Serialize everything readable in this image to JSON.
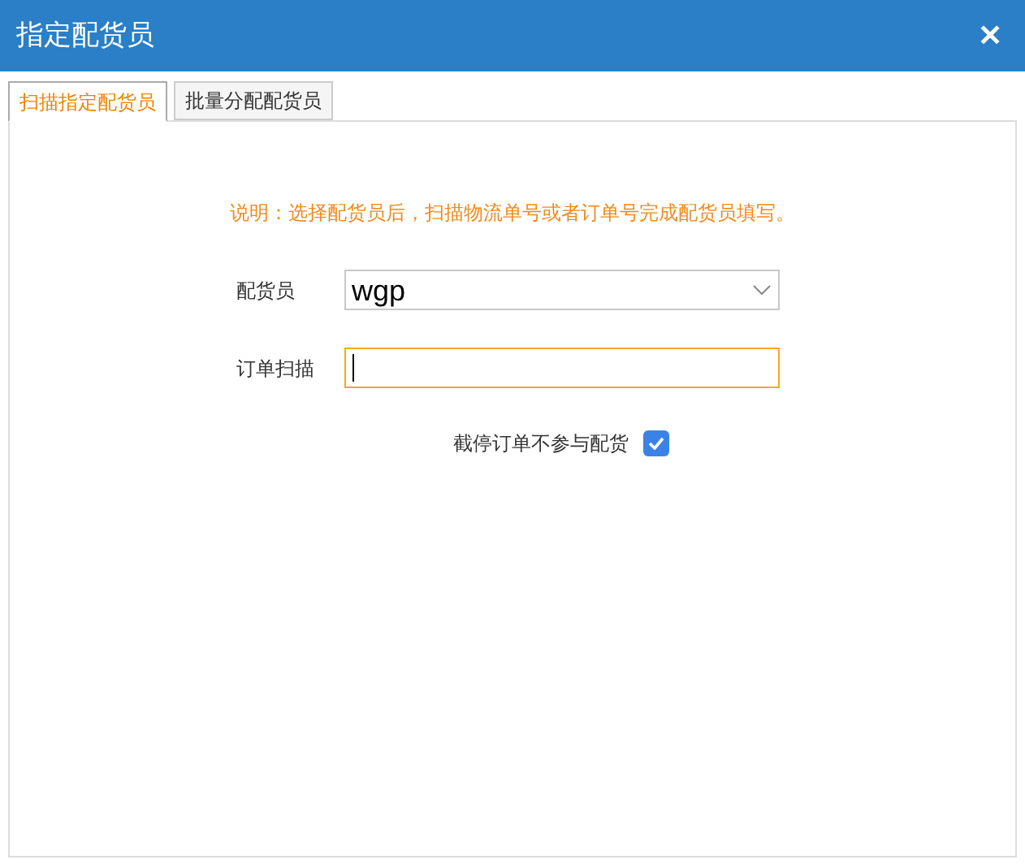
{
  "window": {
    "title": "指定配货员",
    "close": "✕"
  },
  "tabs": [
    {
      "label": "扫描指定配货员",
      "selected": true
    },
    {
      "label": "批量分配配货员",
      "selected": false
    }
  ],
  "note": "说明：选择配货员后，扫描物流单号或者订单号完成配货员填写。",
  "picker": {
    "label": "配货员",
    "value": "wgp"
  },
  "scan": {
    "label": "订单扫描",
    "focused": true
  },
  "exclude": {
    "label": "截停订单不参与配货",
    "checked": true
  }
}
